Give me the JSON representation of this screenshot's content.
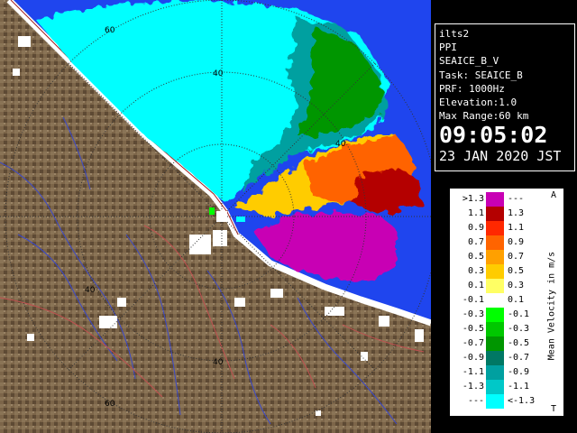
{
  "info": {
    "site": "ilts2",
    "scan_type": "PPI",
    "product": "SEAICE_B_V",
    "task": "Task: SEAICE_B",
    "prf": "PRF: 1000Hz",
    "elevation": "Elevation:1.0",
    "max_range": "Max Range:60 km",
    "time": "09:05:02",
    "date": "23 JAN 2020 JST"
  },
  "map": {
    "range_ring_labels": [
      "60",
      "40",
      "40",
      "40",
      "40",
      "60"
    ],
    "colors": {
      "land": "#7c6549",
      "sea": "#1f45ee",
      "coast_ice": "#ffffff",
      "contour_brown": "#6b4f35",
      "river": "#3a48c8",
      "road": "#c05050",
      "ring": "#333333"
    }
  },
  "legend": {
    "unit_label": "Mean Velocity in m/s",
    "top_marker": "A",
    "bottom_marker": "T",
    "rows": [
      {
        "lo": ">1.3",
        "hi": "---",
        "color": "#c800b4"
      },
      {
        "lo": "1.1",
        "hi": "1.3",
        "color": "#b40000"
      },
      {
        "lo": "0.9",
        "hi": "1.1",
        "color": "#ff2800"
      },
      {
        "lo": "0.7",
        "hi": "0.9",
        "color": "#ff6400"
      },
      {
        "lo": "0.5",
        "hi": "0.7",
        "color": "#ffa000"
      },
      {
        "lo": "0.3",
        "hi": "0.5",
        "color": "#ffcc00"
      },
      {
        "lo": "0.1",
        "hi": "0.3",
        "color": "#ffff64"
      },
      {
        "lo": "-0.1",
        "hi": "0.1",
        "color": "#ffffff"
      },
      {
        "lo": "-0.3",
        "hi": "-0.1",
        "color": "#00ff00"
      },
      {
        "lo": "-0.5",
        "hi": "-0.3",
        "color": "#00c800"
      },
      {
        "lo": "-0.7",
        "hi": "-0.5",
        "color": "#009600"
      },
      {
        "lo": "-0.9",
        "hi": "-0.7",
        "color": "#007864"
      },
      {
        "lo": "-1.1",
        "hi": "-0.9",
        "color": "#00a0a0"
      },
      {
        "lo": "-1.3",
        "hi": "-1.1",
        "color": "#00c8c8"
      },
      {
        "lo": "---",
        "hi": "<-1.3",
        "color": "#00ffff"
      }
    ]
  }
}
